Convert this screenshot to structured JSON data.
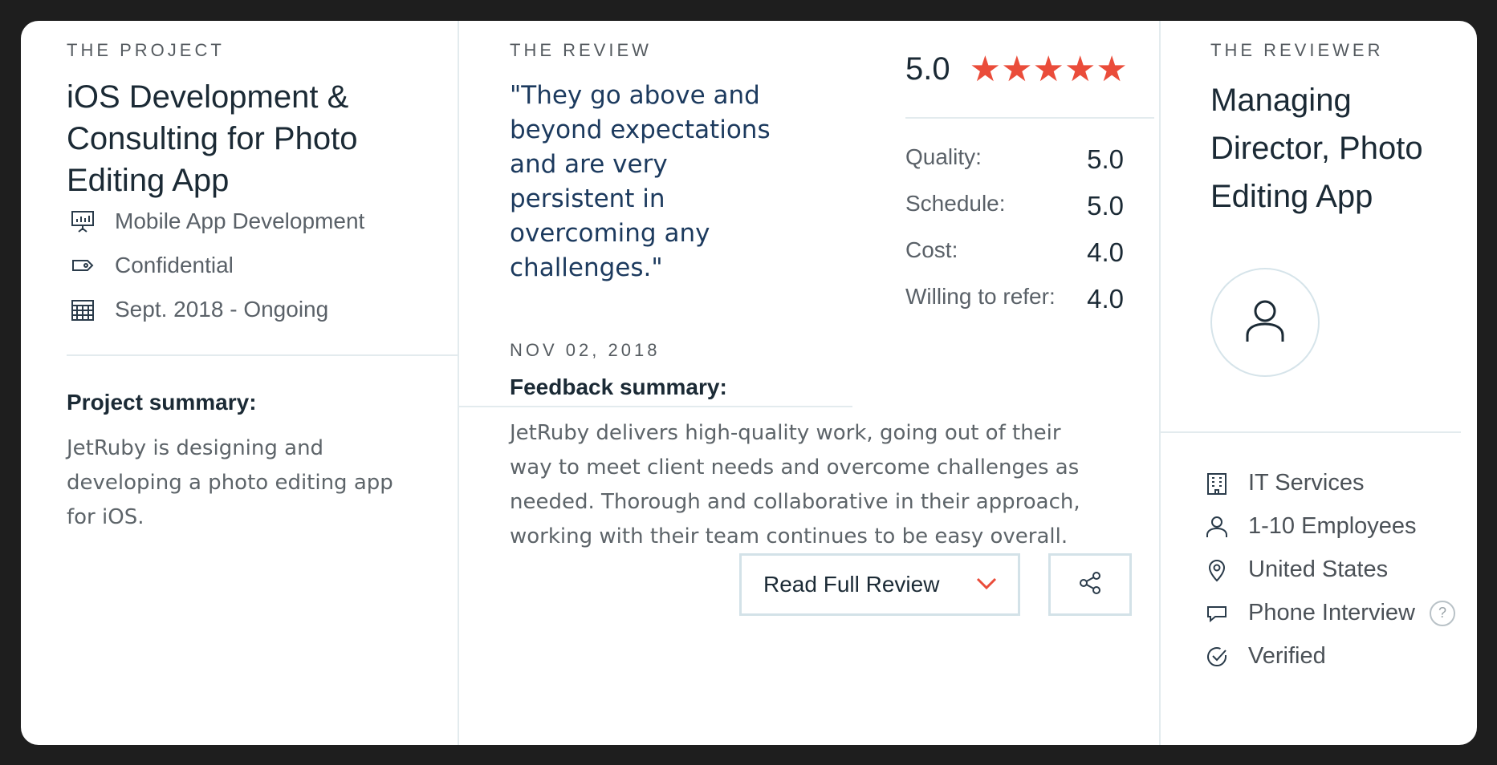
{
  "project": {
    "label": "THE PROJECT",
    "title": "iOS Development & Consulting for Photo Editing App",
    "meta": [
      {
        "icon": "presentation-icon",
        "text": "Mobile App Development"
      },
      {
        "icon": "tag-icon",
        "text": "Confidential"
      },
      {
        "icon": "calendar-icon",
        "text": "Sept. 2018 - Ongoing"
      }
    ],
    "summary_heading": "Project summary:",
    "summary_text": "JetRuby is designing and developing a photo editing app for iOS."
  },
  "review": {
    "label": "THE REVIEW",
    "quote": "\"They go above and beyond expectations and are very persistent in overcoming any challenges.\"",
    "date": "NOV 02, 2018",
    "overall_score": "5.0",
    "stars": 5,
    "star_color": "#ea4c3a",
    "ratings": [
      {
        "label": "Quality:",
        "value": "5.0"
      },
      {
        "label": "Schedule:",
        "value": "5.0"
      },
      {
        "label": "Cost:",
        "value": "4.0"
      },
      {
        "label": "Willing to refer:",
        "value": "4.0"
      }
    ],
    "feedback_heading": "Feedback summary:",
    "feedback_text": "JetRuby delivers high-quality work, going out of their way to meet client needs and overcome challenges as needed. Thorough and collaborative in their approach, working with their team continues to be easy overall.",
    "read_full_label": "Read Full Review",
    "chevron_icon": "chevron-down-icon",
    "share_icon": "share-icon"
  },
  "reviewer": {
    "label": "THE REVIEWER",
    "title": "Managing Director, Photo Editing App",
    "avatar_icon": "user-icon",
    "details": [
      {
        "icon": "building-icon",
        "text": "IT Services"
      },
      {
        "icon": "person-icon",
        "text": "1-10 Employees"
      },
      {
        "icon": "location-pin-icon",
        "text": "United States"
      },
      {
        "icon": "speech-bubble-icon",
        "text": "Phone Interview"
      },
      {
        "icon": "check-circle-icon",
        "text": "Verified"
      }
    ],
    "help_icon": "question-circle-icon"
  }
}
